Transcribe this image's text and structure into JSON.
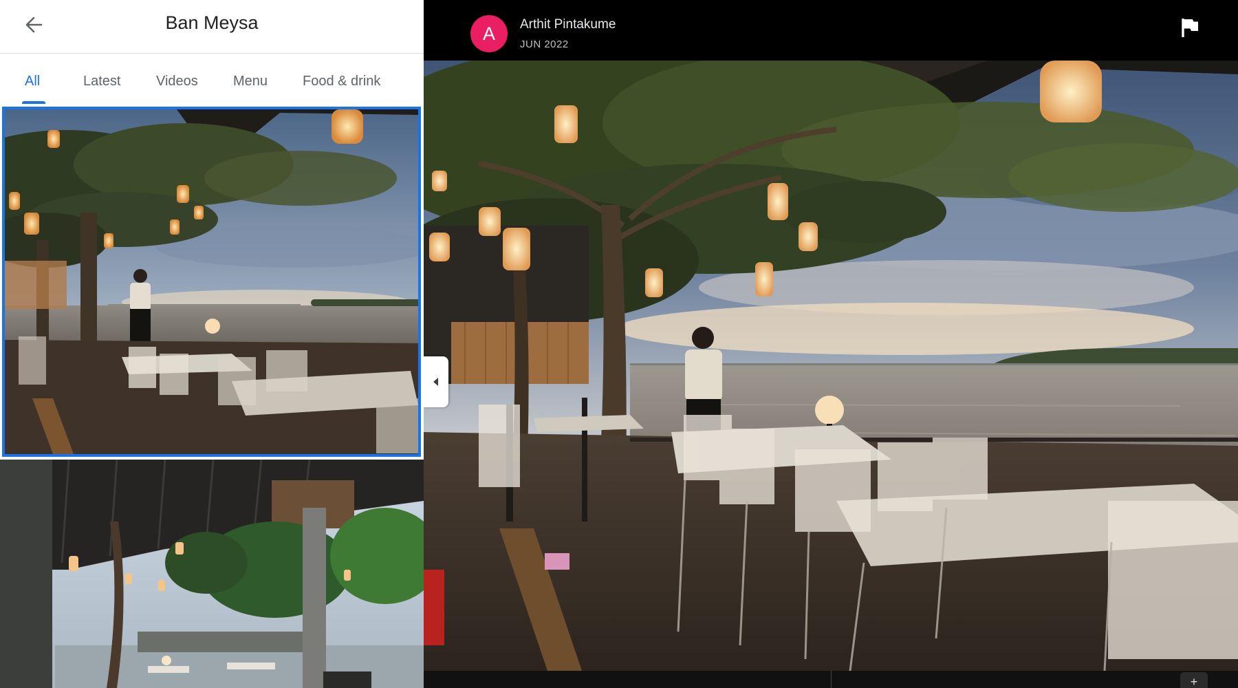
{
  "place": {
    "title": "Ban Meysa"
  },
  "tabs": [
    {
      "label": "All",
      "active": true
    },
    {
      "label": "Latest"
    },
    {
      "label": "Videos"
    },
    {
      "label": "Menu"
    },
    {
      "label": "Food & drink"
    }
  ],
  "viewer": {
    "author": {
      "initial": "A",
      "name": "Arthit Pintakume",
      "date": "JUN 2022",
      "avatar_color": "#e91e63"
    }
  },
  "icons": {
    "back": "arrow-back-icon",
    "flag": "flag-icon",
    "collapse": "chevron-left-icon",
    "add": "plus-icon"
  },
  "colors": {
    "accent": "#1a73e8",
    "avatar": "#e91e63"
  }
}
